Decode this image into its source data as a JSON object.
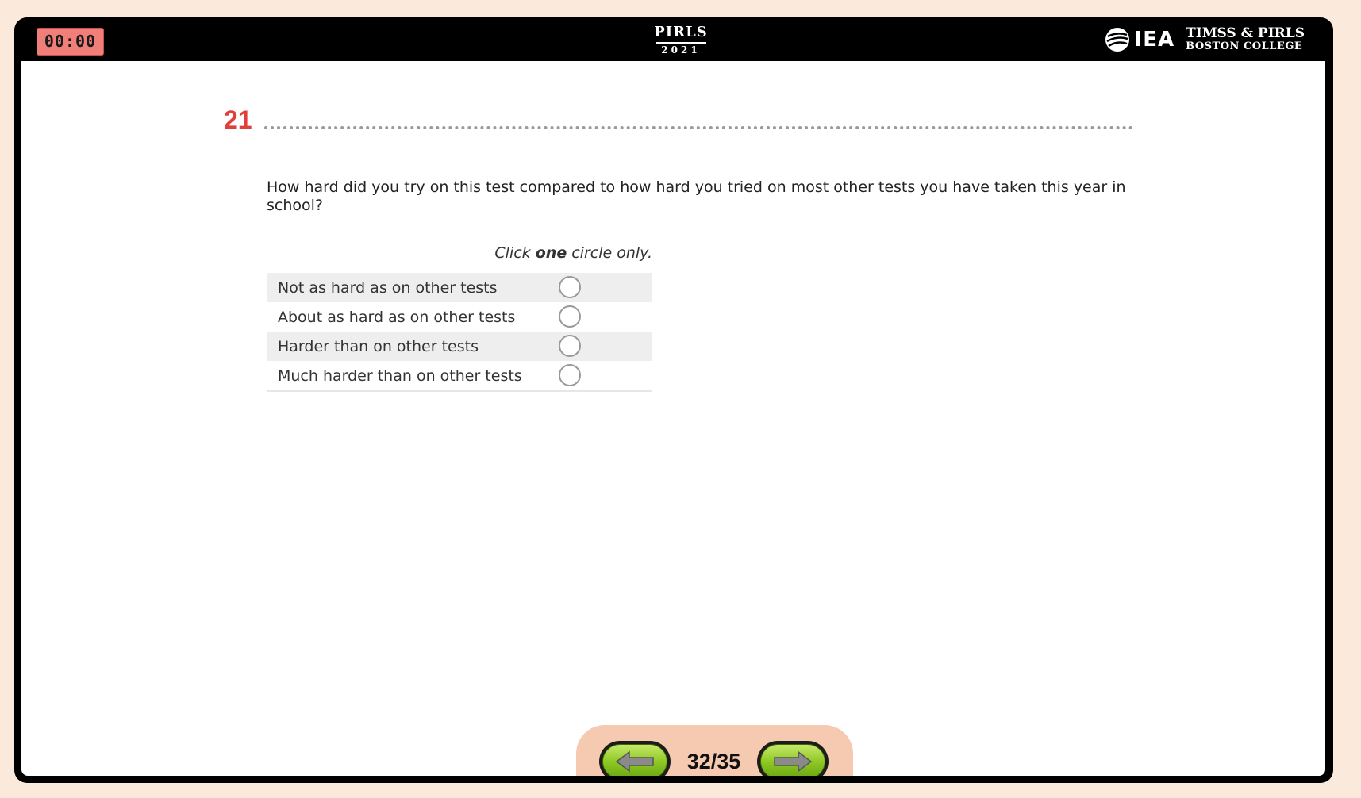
{
  "header": {
    "timer": "00:00",
    "pirls_name": "PIRLS",
    "pirls_year": "2021",
    "iea_label": "IEA",
    "timss_pirls_line1": "TIMSS & PIRLS",
    "timss_pirls_line2": "BOSTON COLLEGE"
  },
  "question": {
    "number": "21",
    "text": "How hard did you try on this test compared to how hard you tried on most other tests you have taken this year in school?",
    "instruction_pre": "Click",
    "instruction_bold": "one",
    "instruction_post": "circle only.",
    "options": [
      {
        "label": "Not as hard as on other tests",
        "selected": false
      },
      {
        "label": "About as hard as on other tests",
        "selected": false
      },
      {
        "label": "Harder than on other tests",
        "selected": false
      },
      {
        "label": "Much harder than on other tests",
        "selected": false
      }
    ]
  },
  "navigation": {
    "page_indicator": "32/35",
    "prev_icon": "arrow-left-icon",
    "next_icon": "arrow-right-icon"
  },
  "colors": {
    "page_background": "#fbe9dc",
    "frame": "#000000",
    "timer_background": "#f07f7a",
    "question_number": "#e0403b",
    "nav_panel": "#f6c9b1",
    "nav_button_green": "#8fc924"
  }
}
